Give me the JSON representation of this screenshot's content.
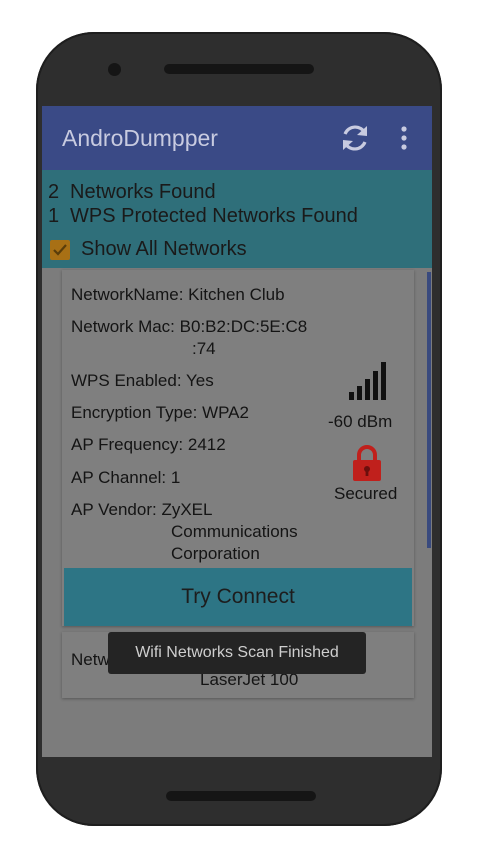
{
  "app": {
    "title": "AndroDumpper",
    "icons": {
      "refresh": "refresh-icon",
      "overflow": "more-vert-icon"
    }
  },
  "summary": {
    "networks_count": "2",
    "networks_label": "Networks Found",
    "wps_count": "1",
    "wps_label": "WPS Protected Networks Found",
    "show_all_label": "Show All Networks",
    "show_all_checked": true
  },
  "network_card": {
    "name_label": "NetworkName:",
    "name_value": "Kitchen Club",
    "mac_label": "Network Mac:",
    "mac_value_line1": "B0:B2:DC:5E:C8",
    "mac_value_line2": ":74",
    "wps_label": "WPS Enabled:",
    "wps_value": "Yes",
    "encryption_label": "Encryption Type:",
    "encryption_value": "WPA2",
    "frequency_label": "AP Frequency:",
    "frequency_value": "2412",
    "channel_label": "AP Channel:",
    "channel_value": "1",
    "vendor_label": "AP Vendor:",
    "vendor_line1": "ZyXEL",
    "vendor_line2": "Communications",
    "vendor_line3": "Corporation",
    "signal": "-60 dBm",
    "security": "Secured",
    "connect_label": "Try Connect"
  },
  "second_card": {
    "label_partial": "Netw",
    "vendor_partial": "LaserJet 100"
  },
  "toast": {
    "message": "Wifi Networks Scan Finished"
  },
  "colors": {
    "appbar": "#3a4a86",
    "summary": "#2f6f7a",
    "connect_button": "#2d7585",
    "lock": "#c0201c",
    "checkbox": "#a87015"
  }
}
